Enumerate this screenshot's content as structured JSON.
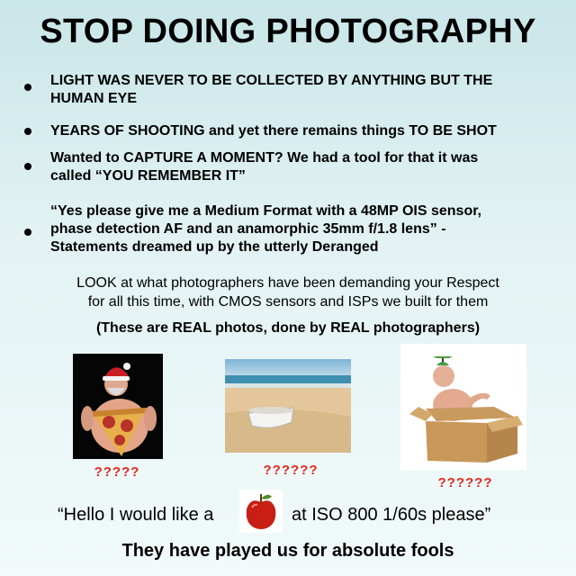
{
  "title": "STOP DOING PHOTOGRAPHY",
  "bullets": [
    {
      "line1": "LIGHT WAS NEVER TO BE COLLECTED BY ANYTHING BUT THE",
      "line2": "HUMAN EYE"
    },
    {
      "part1": "YEARS OF SHOOTING",
      "part2": " and yet there remains things ",
      "part3": "TO BE SHOT"
    },
    {
      "line1": "Wanted to CAPTURE A MOMENT? We had a tool for that it was",
      "line2": "called “YOU REMEMBER IT”"
    },
    {
      "line1": "“Yes please give me a Medium Format with a 48MP OIS sensor,",
      "line2": "phase detection AF and an anamorphic 35mm f/1.8 lens” -",
      "line3": "Statements dreamed up by the utterly Deranged"
    }
  ],
  "look": {
    "line1": "LOOK at what photographers have been demanding your Respect",
    "line2": "for all this time, with CMOS sensors and ISPs we built for them"
  },
  "real": {
    "p1": "(These are ",
    "b1": "REAL",
    "p2": " photos, done by ",
    "b2": "REAL",
    "p3": " photographers)"
  },
  "photos": [
    {
      "icon": "pizza-santa-photo",
      "caption": "?????"
    },
    {
      "icon": "beach-bathtub-photo",
      "caption": "??????"
    },
    {
      "icon": "man-in-box-photo",
      "caption": "??????"
    }
  ],
  "quote": {
    "before": "“Hello I would like a",
    "after": "at  ISO 800 1/60s please”",
    "icon": "apple-icon"
  },
  "final": "They have played us for absolute fools",
  "colors": {
    "question_marks": "#e0281c",
    "background_top": "#c9e6e8"
  }
}
